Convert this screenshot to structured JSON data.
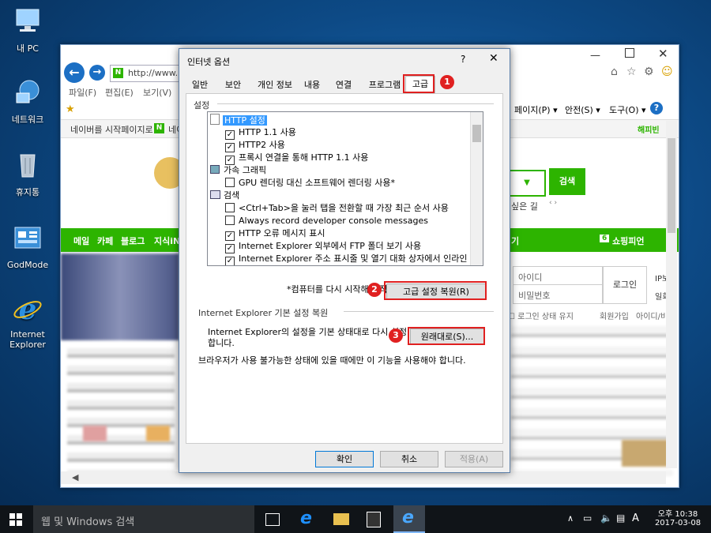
{
  "desktop": {
    "icons": [
      {
        "label": "내 PC"
      },
      {
        "label": "네트워크"
      },
      {
        "label": "휴지통"
      },
      {
        "label": "GodMode"
      },
      {
        "label": "Internet\nExplorer"
      }
    ]
  },
  "ie": {
    "address": "http://www.na",
    "menu": [
      "파일(F)",
      "편집(E)",
      "보기(V)"
    ],
    "fav_links": [
      "네이버를 시작페이지로 ›",
      "네이"
    ],
    "toolbar_right": [
      "페이지(P) ▾",
      "안전(S) ▾",
      "도구(O) ▾"
    ],
    "search_button": "검색",
    "nav_links": [
      "메일",
      "카페",
      "블로그",
      "지식iN"
    ],
    "shopping": "쇼핑피언",
    "shopping_count": "6",
    "login": {
      "id": "아이디",
      "pw": "비밀번호",
      "button": "로그인",
      "ip": "IP보",
      "keep": "일회",
      "remember": "로그인 상태 유지",
      "join": "회원가입",
      "find": "아이디/비"
    },
    "sub_text": "싶은 길",
    "happybean": "해피빈",
    "nav_g": "기"
  },
  "dialog": {
    "title": "인터넷 옵션",
    "help": "?",
    "tabs": [
      "일반",
      "보안",
      "개인 정보",
      "내용",
      "연결",
      "프로그램",
      "고급"
    ],
    "settings_label": "설정",
    "tree": [
      {
        "type": "group",
        "label": "HTTP 설정",
        "selected": true
      },
      {
        "type": "check",
        "checked": true,
        "label": "HTTP 1.1 사용"
      },
      {
        "type": "check",
        "checked": true,
        "label": "HTTP2 사용"
      },
      {
        "type": "check",
        "checked": true,
        "label": "프록시 연결을 통해 HTTP 1.1 사용"
      },
      {
        "type": "group",
        "label": "가속 그래픽"
      },
      {
        "type": "check",
        "checked": false,
        "label": "GPU 렌더링 대신 소프트웨어 렌더링 사용*"
      },
      {
        "type": "group",
        "label": "검색"
      },
      {
        "type": "check",
        "checked": false,
        "label": "<Ctrl+Tab>을 눌러 탭을 전환할 때 가장 최근 순서 사용"
      },
      {
        "type": "check",
        "checked": false,
        "label": "Always record developer console messages"
      },
      {
        "type": "check",
        "checked": true,
        "label": "HTTP 오류 메시지 표시"
      },
      {
        "type": "check",
        "checked": true,
        "label": "Internet Explorer 외부에서 FTP 폴더 보기 사용"
      },
      {
        "type": "check",
        "checked": true,
        "label": "Internet Explorer 주소 표시줄 및 열기 대화 상자에서 인라인 자"
      }
    ],
    "restart_note": "*컴퓨터를 다시 시작해야 적용됩니다.",
    "restore_adv": "고급 설정 복원(R)",
    "reset_group": "Internet Explorer 기본 설정 복원",
    "reset_desc_1": "Internet Explorer의 설정을 기본 상태대로 다시 설정",
    "reset_desc_2": "합니다.",
    "reset_button": "원래대로(S)...",
    "warning": "브라우저가 사용 불가능한 상태에 있을 때에만 이 기능을 사용해야 합니다.",
    "ok": "확인",
    "cancel": "취소",
    "apply": "적용(A)",
    "badges": [
      "1",
      "2",
      "3"
    ]
  },
  "taskbar": {
    "search": "웹 및 Windows 검색",
    "ime": "A",
    "time": "오후 10:38",
    "date": "2017-03-08"
  },
  "colors": {
    "accent": "#e02020",
    "naver_green": "#2db400",
    "highlight": "#3399ff"
  }
}
